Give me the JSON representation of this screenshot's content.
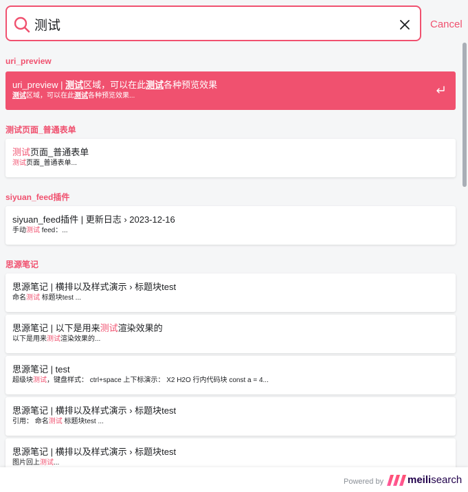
{
  "search": {
    "value": "测试",
    "cancel_label": "Cancel"
  },
  "groups": [
    {
      "title": "uri_preview",
      "hits": [
        {
          "title": [
            {
              "t": "uri_preview | "
            },
            {
              "t": "测试",
              "h": true
            },
            {
              "t": "区域，可以在此"
            },
            {
              "t": "测试",
              "h": true
            },
            {
              "t": "各种预览效果"
            }
          ],
          "path": [
            {
              "t": "测试",
              "h": true
            },
            {
              "t": "区域，可以在此"
            },
            {
              "t": "测试",
              "h": true
            },
            {
              "t": "各种预览效果..."
            }
          ],
          "selected": true
        }
      ]
    },
    {
      "title": "测试页面_普通表单",
      "hits": [
        {
          "title": [
            {
              "t": "测试",
              "h": true
            },
            {
              "t": "页面_普通表单"
            }
          ],
          "path": [
            {
              "t": "测试",
              "h": true
            },
            {
              "t": "页面_普通表单..."
            }
          ]
        }
      ]
    },
    {
      "title": "siyuan_feed插件",
      "hits": [
        {
          "title": [
            {
              "t": "siyuan_feed插件 | 更新日志 › 2023-12-16"
            }
          ],
          "path": [
            {
              "t": "手动"
            },
            {
              "t": "测试",
              "h": true
            },
            {
              "t": " feed：..."
            }
          ]
        }
      ]
    },
    {
      "title": "思源笔记",
      "hits": [
        {
          "title": [
            {
              "t": "思源笔记 | 横排以及样式演示 › 标题块test"
            }
          ],
          "path": [
            {
              "t": "命名"
            },
            {
              "t": "测试",
              "h": true
            },
            {
              "t": " 标题块test ..."
            }
          ]
        },
        {
          "title": [
            {
              "t": "思源笔记 | 以下是用来"
            },
            {
              "t": "测试",
              "h": true
            },
            {
              "t": "渲染效果的"
            }
          ],
          "path": [
            {
              "t": "以下是用来"
            },
            {
              "t": "测试",
              "h": true
            },
            {
              "t": "渲染效果的..."
            }
          ]
        },
        {
          "title": [
            {
              "t": "思源笔记 | test"
            }
          ],
          "path": [
            {
              "t": "超级块"
            },
            {
              "t": "测试",
              "h": true
            },
            {
              "t": "，键盘样式：  ctrl+space 上下标演示：  X2 H2O 行内代码块 const a = 4..."
            }
          ]
        },
        {
          "title": [
            {
              "t": "思源笔记 | 横排以及样式演示 › 标题块test"
            }
          ],
          "path": [
            {
              "t": "引用：  命名"
            },
            {
              "t": "测试",
              "h": true
            },
            {
              "t": " 标题块test ..."
            }
          ]
        },
        {
          "title": [
            {
              "t": "思源笔记 | 横排以及样式演示 › 标题块test"
            }
          ],
          "path": [
            {
              "t": "图片回上"
            },
            {
              "t": "测试",
              "h": true
            },
            {
              "t": "..."
            }
          ]
        }
      ]
    }
  ],
  "footer": {
    "powered_by": "Powered by",
    "brand_a": "meili",
    "brand_b": "search"
  },
  "colors": {
    "accent": "#f0516f",
    "brand_text": "#21004b"
  },
  "icons": {
    "search": "search-icon",
    "clear": "close-icon",
    "enter": "enter-return-icon",
    "logo": "meilisearch-logo"
  }
}
